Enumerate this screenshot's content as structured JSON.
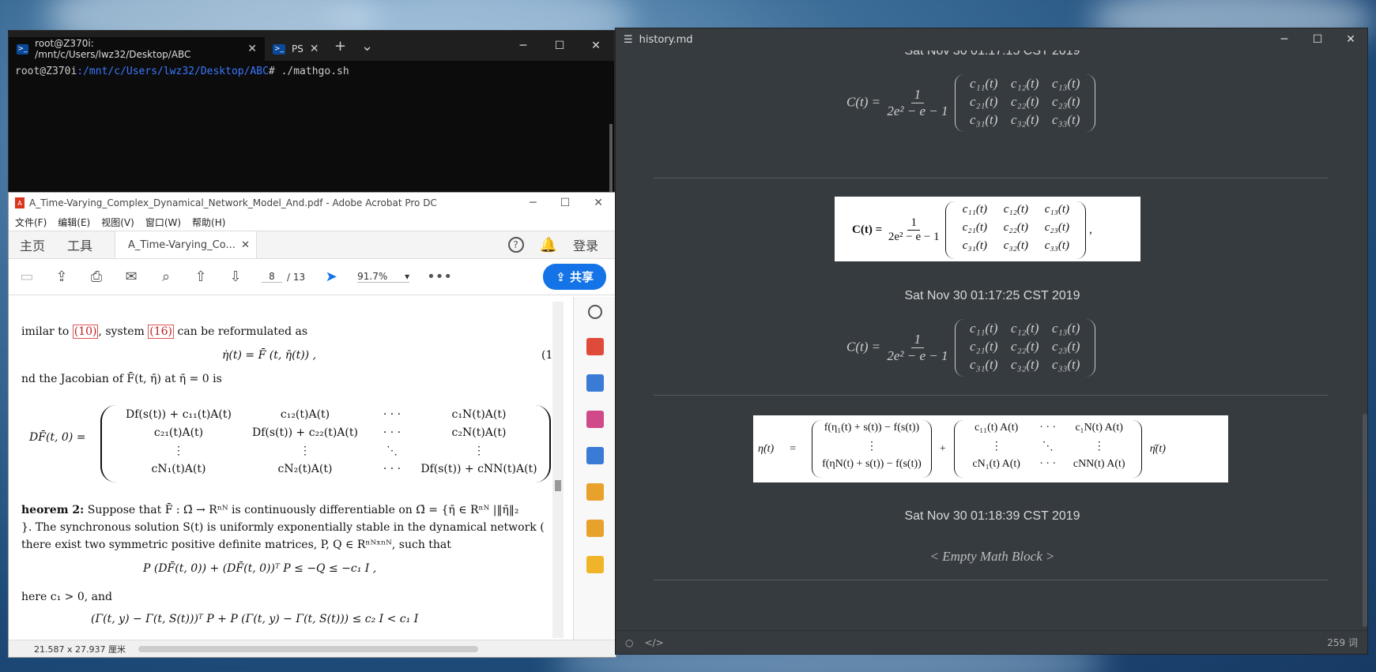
{
  "terminal": {
    "tab_active": "root@Z370i: /mnt/c/Users/lwz32/Desktop/ABC",
    "tab_second": "PS",
    "prompt_user": "root@Z370i",
    "prompt_path": ":/mnt/c/Users/lwz32/Desktop/ABC",
    "prompt_cmd": "# ./mathgo.sh"
  },
  "acrobat": {
    "title": "A_Time-Varying_Complex_Dynamical_Network_Model_And.pdf - Adobe Acrobat Pro DC",
    "menu": [
      "文件(F)",
      "编辑(E)",
      "视图(V)",
      "窗口(W)",
      "帮助(H)"
    ],
    "nav_home": "主页",
    "nav_tools": "工具",
    "doc_tab": "A_Time-Varying_Co...",
    "login": "登录",
    "page_current": "8",
    "page_total": "/ 13",
    "zoom": "91.7%",
    "share": "共享",
    "status_size": "21.587 x 27.937 厘米",
    "doc": {
      "line1a": "imilar to ",
      "ref10": "(10)",
      "line1b": ", system ",
      "ref16": "(16)",
      "line1c": " can be reformulated as",
      "eq1": "η̇(t) = F̄ (t, η̄(t)) ,",
      "eq1_num": "(1",
      "line2": "nd the Jacobian of F̄(t, η̄) at η̄ = 0 is",
      "jac_label": "DF̄(t, 0) =",
      "jac_rows": [
        [
          "Df(s(t)) + c₁₁(t)A(t)",
          "c₁₂(t)A(t)",
          "· · ·",
          "c₁N(t)A(t)"
        ],
        [
          "c₂₁(t)A(t)",
          "Df(s(t)) + c₂₂(t)A(t)",
          "· · ·",
          "c₂N(t)A(t)"
        ],
        [
          "⋮",
          "⋮",
          "⋱",
          "⋮"
        ],
        [
          "cN₁(t)A(t)",
          "cN₂(t)A(t)",
          "· · ·",
          "Df(s(t)) + cNN(t)A(t)"
        ]
      ],
      "thm_label": "heorem 2:",
      "thm_text": " Suppose that F̄ : Ω̄ → Rⁿᴺ is continuously differentiable on Ω̄ = {η̄ ∈ Rⁿᴺ |‖η̄‖₂",
      "thm_line2": "}. The synchronous solution S(t) is uniformly exponentially stable in the dynamical network (",
      "thm_line3": " there exist two symmetric positive definite matrices, P, Q ∈ Rⁿᴺˣⁿᴺ, such that",
      "eq2": "P (DF̄(t, 0)) + (DF̄(t, 0))ᵀ P ≤ −Q ≤ −c₁ I ,",
      "line_here": "here c₁ > 0, and",
      "eq3": "(Γ(t, y) − Γ(t, S(t)))ᵀ P + P (Γ(t, y) − Γ(t, S(t))) ≤ c₂ I < c₁ I"
    }
  },
  "typora": {
    "title": "history.md",
    "timestamps": [
      "Sat Nov 30 01:17:15 CST 2019",
      "Sat Nov 30 01:17:25 CST 2019",
      "Sat Nov 30 01:18:39 CST 2019"
    ],
    "eq_lhs": "C(t) =",
    "eq_lhs_bold": "C(t) =",
    "frac_num": "1",
    "frac_den": "2e² − e − 1",
    "matrix": [
      [
        "c₁₁(t)",
        "c₁₂(t)",
        "c₁₃(t)"
      ],
      [
        "c₂₁(t)",
        "c₂₂(t)",
        "c₂₃(t)"
      ],
      [
        "c₃₁(t)",
        "c₃₂(t)",
        "c₃₃(t)"
      ]
    ],
    "trailing_comma": ",",
    "eta_lhs": "η̇(t)",
    "eta_eq": "=",
    "eta_vec": [
      "f(η₁(t) + s(t)) − f(s(t))",
      "⋮",
      "f(ηN(t) + s(t)) − f(s(t))"
    ],
    "eta_plus": "+",
    "eta_mat": [
      [
        "c₁₁(t) A(t)",
        "· · ·",
        "c₁N(t) A(t)"
      ],
      [
        "⋮",
        "⋱",
        "⋮"
      ],
      [
        "cN₁(t) A(t)",
        "· · ·",
        "cNN(t) A(t)"
      ]
    ],
    "eta_rhs": "η̄(t)",
    "empty_block": "< Empty Math Block >",
    "word_count": "259 词"
  }
}
